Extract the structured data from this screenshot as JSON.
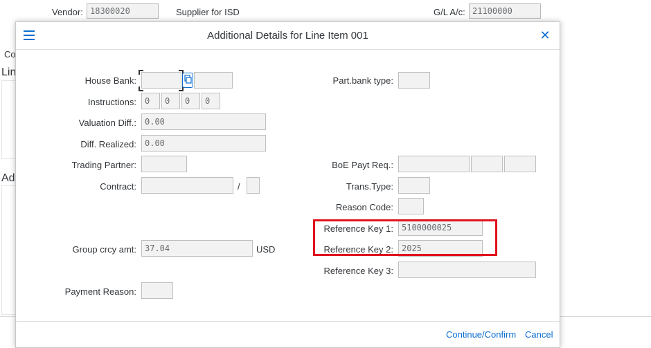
{
  "background": {
    "vendor_label": "Vendor:",
    "vendor_value": "18300020",
    "supplier_text": "Supplier for ISD",
    "gl_label": "G/L A/c:",
    "gl_value": "21100000",
    "left_fragment_1": "Co",
    "left_fragment_2": "Lin",
    "left_fragment_3": "Ad"
  },
  "dialog": {
    "title": "Additional Details for Line Item 001",
    "left": {
      "house_bank_label": "House Bank:",
      "house_bank_value": "",
      "account_id_value": "",
      "instructions_label": "Instructions:",
      "instructions_values": [
        "0",
        "0",
        "0",
        "0"
      ],
      "valuation_diff_label": "Valuation Diff.:",
      "valuation_diff_value": "0.00",
      "diff_realized_label": "Diff. Realized:",
      "diff_realized_value": "0.00",
      "trading_partner_label": "Trading Partner:",
      "trading_partner_value": "",
      "contract_label": "Contract:",
      "contract_value": "",
      "contract_separator": "/",
      "contract_type_value": "",
      "group_crcy_label": "Group crcy amt:",
      "group_crcy_value": "37.04",
      "group_crcy_unit": "USD",
      "payment_reason_label": "Payment Reason:",
      "payment_reason_value": ""
    },
    "right": {
      "part_bank_type_label": "Part.bank type:",
      "part_bank_type_value": "",
      "boe_label": "BoE Payt Req.:",
      "boe_values": [
        "",
        "",
        ""
      ],
      "trans_type_label": "Trans.Type:",
      "trans_type_value": "",
      "reason_code_label": "Reason Code:",
      "reason_code_value": "",
      "ref_key1_label": "Reference Key 1:",
      "ref_key1_value": "5100000025",
      "ref_key2_label": "Reference Key 2:",
      "ref_key2_value": "2025",
      "ref_key3_label": "Reference Key 3:",
      "ref_key3_value": ""
    },
    "footer": {
      "continue_label": "Continue/Confirm",
      "cancel_label": "Cancel"
    }
  },
  "colors": {
    "accent": "#0a6ed1",
    "highlight": "#e0121d"
  },
  "icons": {
    "menu": "hamburger-menu-icon",
    "close": "close-icon",
    "copy": "copy-icon"
  }
}
